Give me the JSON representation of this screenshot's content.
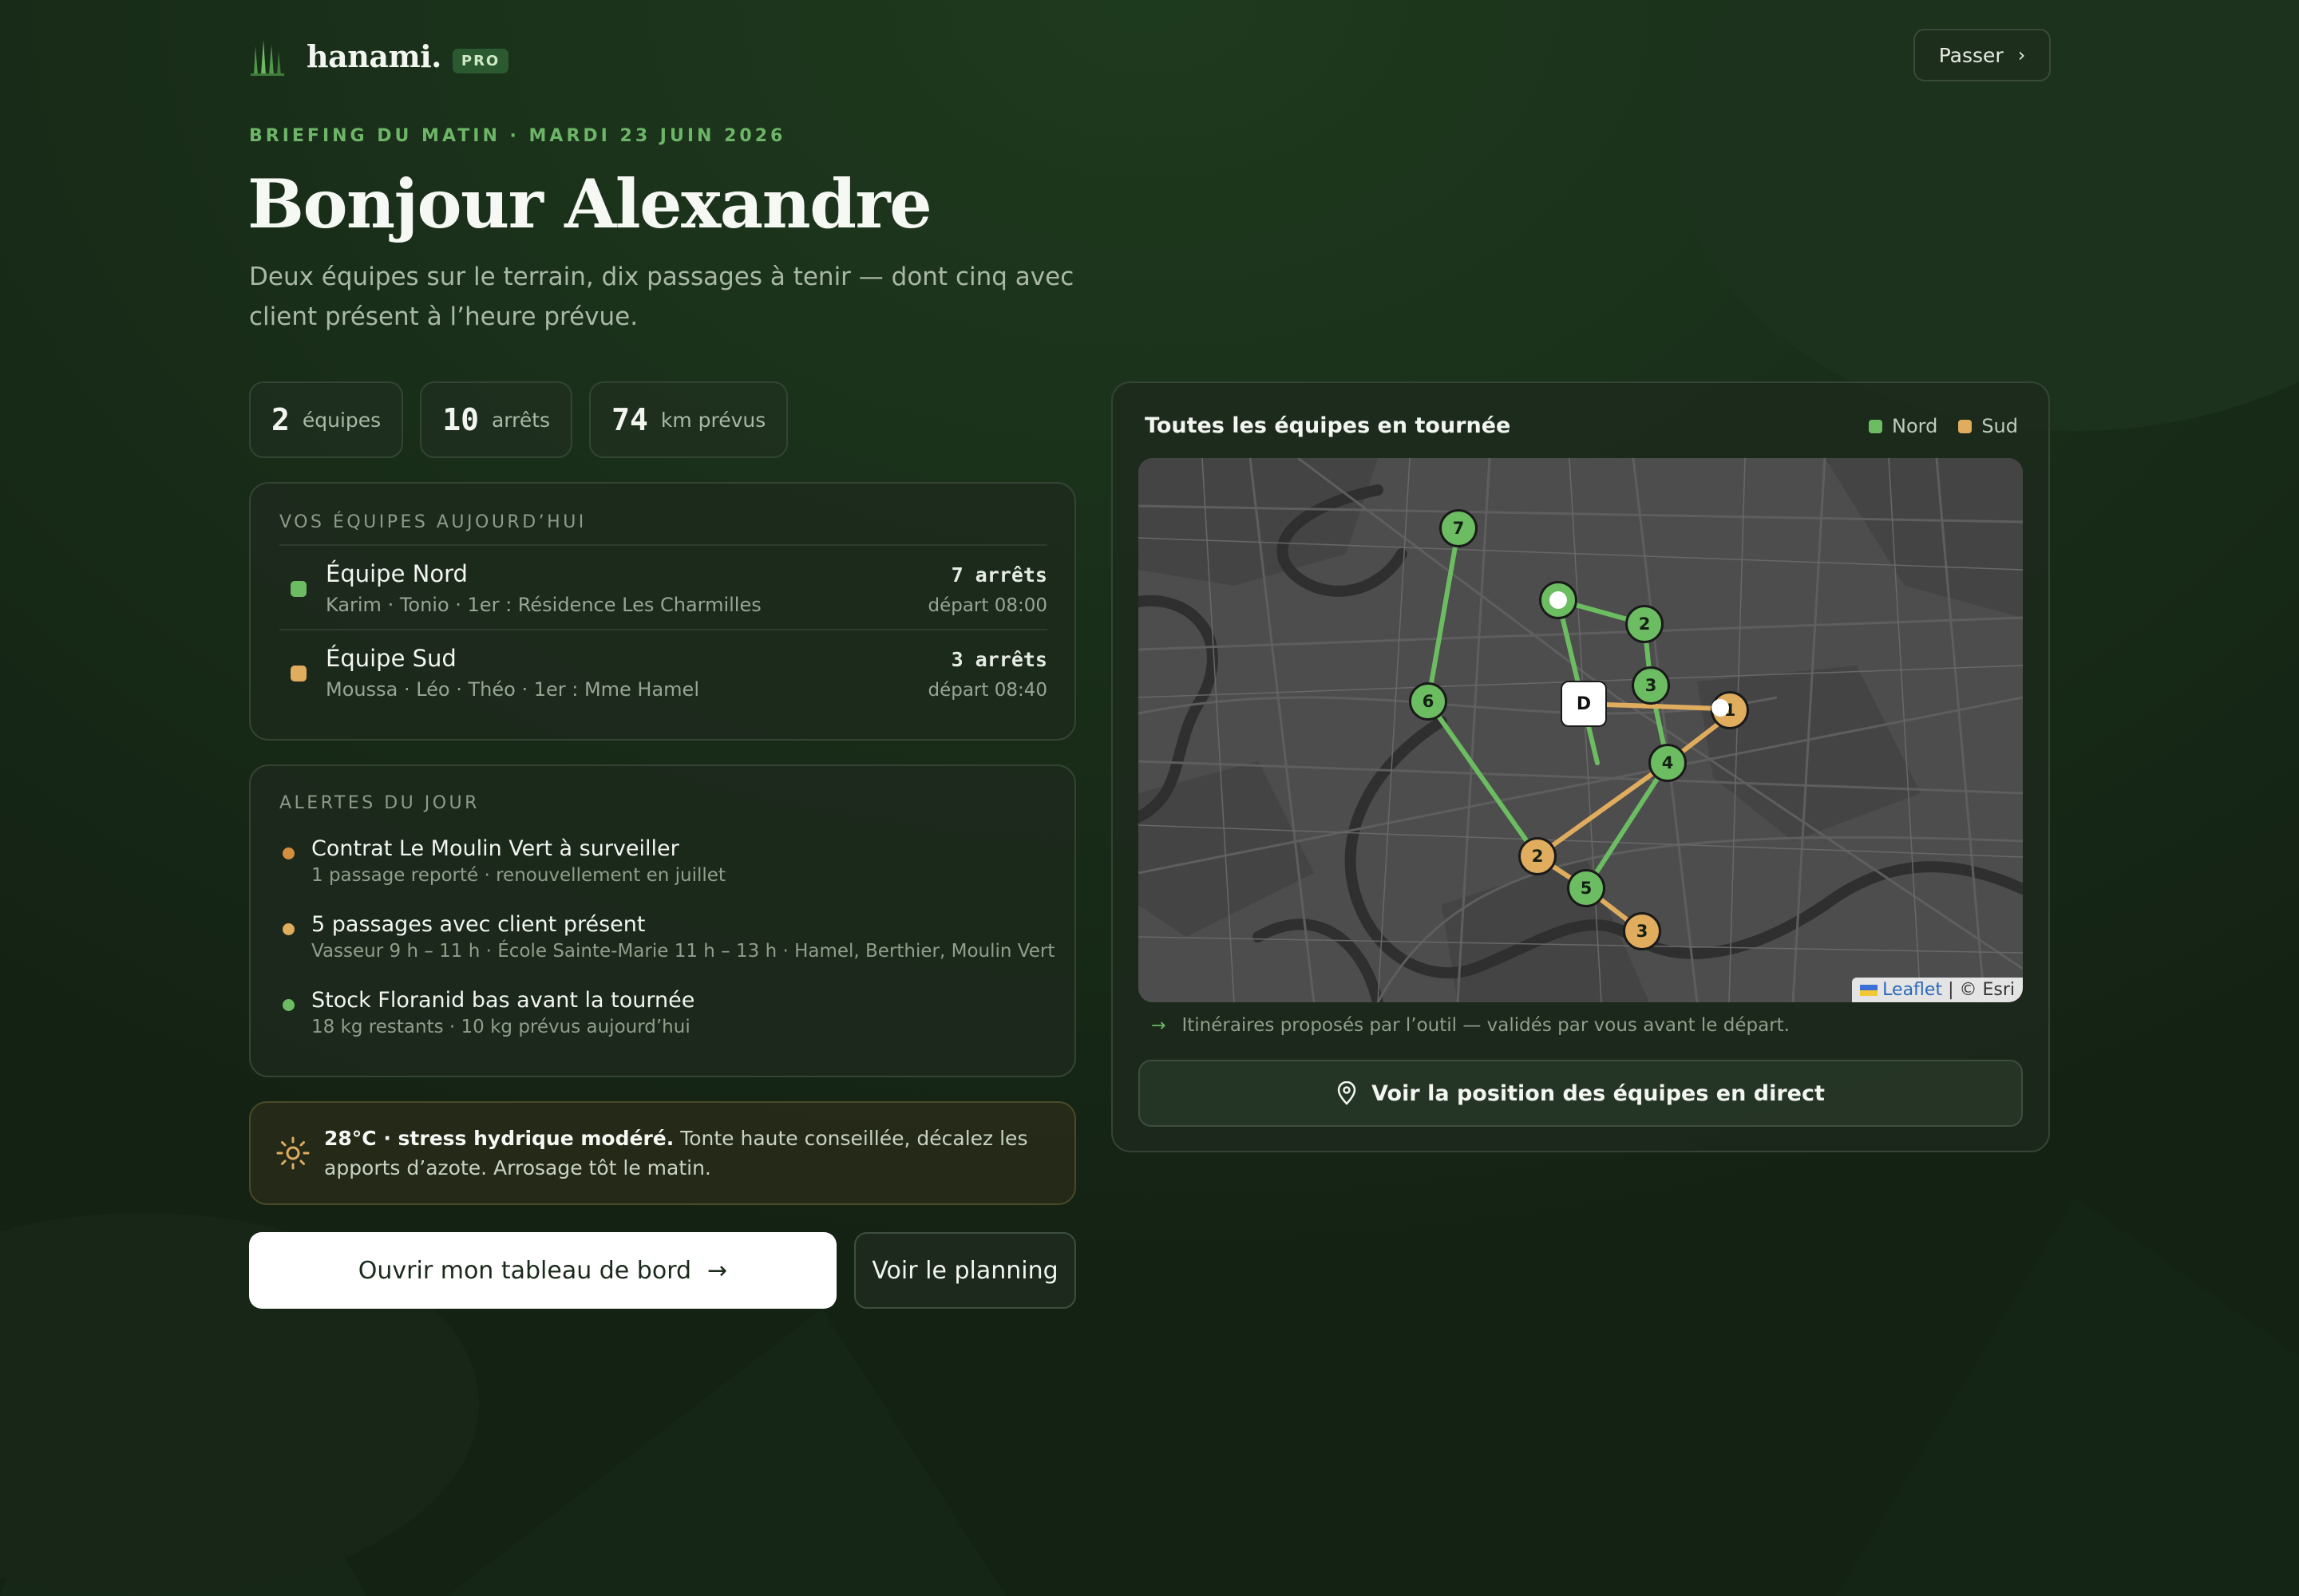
{
  "brand": {
    "name": "hanami.",
    "badge": "PRO"
  },
  "header": {
    "skip_label": "Passer",
    "skip_icon": "chevron-right-icon"
  },
  "briefing": {
    "eyebrow": "BRIEFING DU MATIN · MARDI 23 JUIN 2026",
    "title": "Bonjour Alexandre",
    "subtitle": "Deux équipes sur le terrain, dix passages à tenir — dont cinq avec client présent à l’heure prévue."
  },
  "stats": [
    {
      "value": "2",
      "label": "équipes"
    },
    {
      "value": "10",
      "label": "arrêts"
    },
    {
      "value": "74",
      "label": "km prévus"
    }
  ],
  "teams": {
    "heading": "VOS ÉQUIPES AUJOURD’HUI",
    "items": [
      {
        "name": "Équipe Nord",
        "members": "Karim · Tonio · 1er : Résidence Les Charmilles",
        "stops": "7 arrêts",
        "departure": "départ 08:00",
        "color": "#6cbd62"
      },
      {
        "name": "Équipe Sud",
        "members": "Moussa · Léo · Théo · 1er : Mme Hamel",
        "stops": "3 arrêts",
        "departure": "départ 08:40",
        "color": "#e0ac5e"
      }
    ]
  },
  "alerts": {
    "heading": "ALERTES DU JOUR",
    "items": [
      {
        "title": "Contrat Le Moulin Vert à surveiller",
        "detail": "1 passage reporté · renouvellement en juillet",
        "color": "#d48f3e"
      },
      {
        "title": "5 passages avec client présent",
        "detail": "Vasseur 9 h – 11 h · École Sainte-Marie 11 h – 13 h · Hamel, Berthier, Moulin Vert",
        "color": "#e0ac5e"
      },
      {
        "title": "Stock Floranid bas avant la tournée",
        "detail": "18 kg restants · 10 kg prévus aujourd’hui",
        "color": "#6cbd62"
      }
    ]
  },
  "weather": {
    "icon": "sun-icon",
    "headline": "28°C · stress hydrique modéré.",
    "text": "Tonte haute conseillée, décalez les apports d’azote. Arrosage tôt le matin."
  },
  "actions": {
    "primary": "Ouvrir mon tableau de bord",
    "secondary": "Voir le planning"
  },
  "map": {
    "title": "Toutes les équipes en tournée",
    "legend": [
      {
        "name": "Nord",
        "color": "#6cbd62"
      },
      {
        "name": "Sud",
        "color": "#e0ac5e"
      }
    ],
    "depot_label": "D",
    "north_stops": [
      "2",
      "3",
      "4",
      "5",
      "6",
      "7"
    ],
    "south_stops": [
      "1",
      "2",
      "3"
    ],
    "attribution_link": "Leaflet",
    "attribution_rest": "| © Esri",
    "note": "Itinéraires proposés par l’outil — validés par vous avant le départ.",
    "live_button": "Voir la position des équipes en direct"
  }
}
